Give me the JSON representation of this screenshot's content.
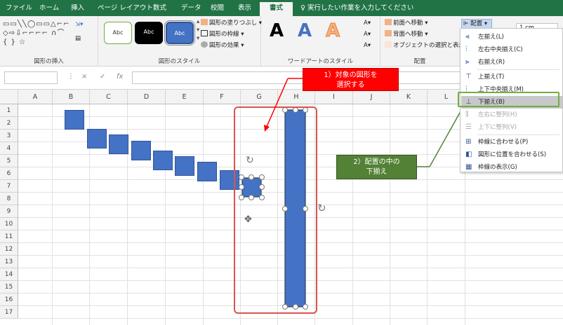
{
  "tabs": [
    "ファイル",
    "ホーム",
    "挿入",
    "ページ レイアウト",
    "数式",
    "データ",
    "校閲",
    "表示",
    "書式"
  ],
  "active_tab": "書式",
  "tell_me": "実行したい作業を入力してください",
  "ribbon": {
    "shape_insert_label": "図形の挿入",
    "shape_glyphs": "▭▭╲╲◯▭▭△⌐⌐◇⇨⇩⌐⌐⌐⌐ ∩⌒ { } ☆",
    "shape_styles": [
      "Abc",
      "Abc",
      "Abc"
    ],
    "fill_label": "図形の塗りつぶし",
    "outline_label": "図形の枠線",
    "effect_label": "図形の効果",
    "shape_style_label": "図形のスタイル",
    "wordart_letters": [
      "A",
      "A",
      "A"
    ],
    "wordart_label": "ワードアートのスタイル",
    "bring_forward": "前面へ移動",
    "send_backward": "背面へ移動",
    "select_pane": "オブジェクトの選択と表示",
    "arrange_label": "配置",
    "align_button": "配置",
    "size_value": "1 cm"
  },
  "formula": {
    "name_box": "",
    "cancel": "×",
    "enter": "✓",
    "fx": "fx",
    "value": ""
  },
  "columns": [
    "A",
    "B",
    "C",
    "D",
    "E",
    "F",
    "G",
    "H",
    "I",
    "J",
    "K",
    "L"
  ],
  "rows": [
    "1",
    "2",
    "3",
    "4",
    "5",
    "6",
    "7",
    "8",
    "9",
    "10",
    "11",
    "12",
    "13",
    "14",
    "15",
    "16",
    "17"
  ],
  "align_menu": [
    {
      "label": "左揃え(L)",
      "enabled": true,
      "selected": false,
      "icon": "align-left-icon"
    },
    {
      "label": "左右中央揃え(C)",
      "enabled": true,
      "selected": false,
      "icon": "align-center-icon"
    },
    {
      "label": "右揃え(R)",
      "enabled": true,
      "selected": false,
      "icon": "align-right-icon"
    },
    {
      "label": "上揃え(T)",
      "enabled": true,
      "selected": false,
      "icon": "align-top-icon"
    },
    {
      "label": "上下中央揃え(M)",
      "enabled": true,
      "selected": false,
      "icon": "align-middle-icon"
    },
    {
      "label": "下揃え(B)",
      "enabled": true,
      "selected": true,
      "icon": "align-bottom-icon"
    },
    {
      "label": "左右に整列(H)",
      "enabled": false,
      "selected": false,
      "icon": "distribute-horizontal-icon"
    },
    {
      "label": "上下に整列(V)",
      "enabled": false,
      "selected": false,
      "icon": "distribute-vertical-icon"
    },
    {
      "label": "枠線に合わせる(P)",
      "enabled": true,
      "selected": false,
      "icon": "snap-to-grid-icon"
    },
    {
      "label": "図形に位置を合わせる(S)",
      "enabled": true,
      "selected": false,
      "icon": "snap-to-shape-icon"
    },
    {
      "label": "枠線の表示(G)",
      "enabled": true,
      "selected": false,
      "icon": "view-gridlines-icon"
    }
  ],
  "callout1": {
    "line1": "1）対象の図形を",
    "line2": "選択する"
  },
  "callout2": {
    "line1": "2）配置の中の",
    "line2": "下揃え"
  },
  "colors": {
    "excel_green": "#217346",
    "shape_blue": "#4472c4",
    "callout_red": "#ff0000",
    "callout_green": "#538135",
    "highlight": "#d9534f"
  }
}
